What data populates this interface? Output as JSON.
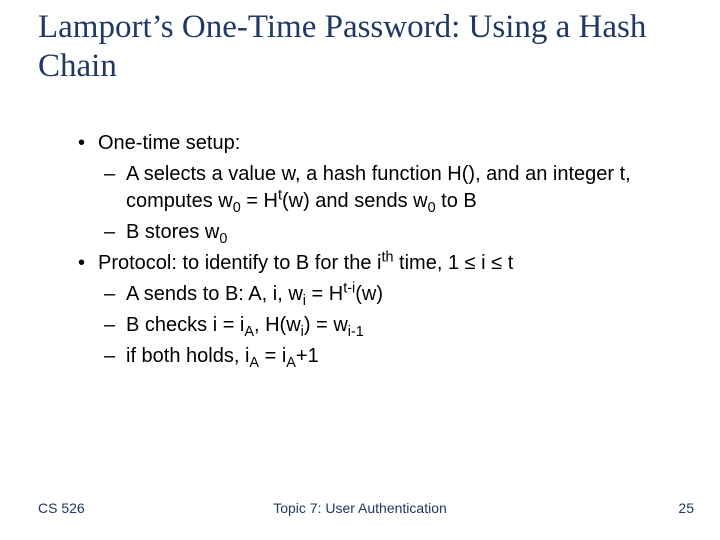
{
  "title": "Lamport’s One-Time Password: Using a Hash Chain",
  "bullets": {
    "b1": "One-time setup:",
    "b1a_pre": "A selects a value w, a hash function H(), and an integer t, computes w",
    "b1a_sub0a": "0",
    "b1a_mid": " = H",
    "b1a_supt": "t",
    "b1a_mid2": "(w) and sends w",
    "b1a_sub0b": "0",
    "b1a_post": " to B",
    "b1b_pre": "B stores w",
    "b1b_sub0": "0",
    "b2_pre": "Protocol: to identify to B for the i",
    "b2_supth": "th",
    "b2_mid": " time, 1 ",
    "b2_le1": "≤",
    "b2_mid2": " i ",
    "b2_le2": "≤",
    "b2_post": " t",
    "b2a_pre": "A sends to B:   A, i, w",
    "b2a_subi": "i",
    "b2a_mid": " = H",
    "b2a_supti": "t-i",
    "b2a_post": "(w)",
    "b2b_pre": "B checks i = i",
    "b2b_subA": "A",
    "b2b_mid": ", H(w",
    "b2b_subi": "i",
    "b2b_mid2": ") =  w",
    "b2b_subim1": "i-1",
    "b2c_pre": "if both holds, i",
    "b2c_subA1": "A",
    "b2c_mid": " = i",
    "b2c_subA2": "A",
    "b2c_post": "+1"
  },
  "footer": {
    "left": "CS 526",
    "center": "Topic 7: User Authentication",
    "right": "25"
  }
}
